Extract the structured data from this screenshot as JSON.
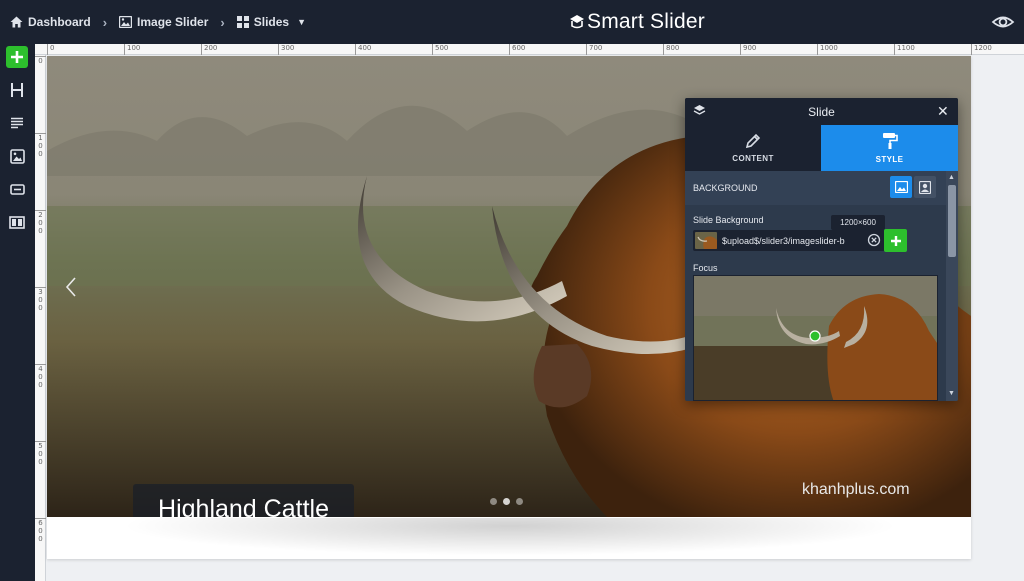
{
  "breadcrumb": {
    "items": [
      {
        "label": "Dashboard",
        "icon": "home-icon"
      },
      {
        "label": "Image Slider",
        "icon": "image-icon"
      },
      {
        "label": "Slides",
        "icon": "grid-icon"
      }
    ]
  },
  "logo": {
    "text": "Smart Slider"
  },
  "ruler": {
    "h_ticks": [
      "0",
      "100",
      "200",
      "300",
      "400",
      "500",
      "600",
      "700",
      "800",
      "900",
      "1000",
      "1100",
      "1200"
    ],
    "v_ticks": [
      "0",
      "1\n0\n0",
      "2\n0\n0",
      "3\n0\n0",
      "4\n0\n0",
      "5\n0\n0",
      "6\n0\n0"
    ]
  },
  "slide": {
    "caption": "Highland Cattle",
    "watermark": "khanhplus.com",
    "dots": 3
  },
  "panel": {
    "title": "Slide",
    "tabs": {
      "content": "CONTENT",
      "style": "STYLE"
    },
    "section_title": "BACKGROUND",
    "slide_background_label": "Slide Background",
    "size_badge": "1200×600",
    "file_value": "$upload$/slider3/imageslider-b",
    "focus_label": "Focus"
  },
  "colors": {
    "topbar": "#1b2230",
    "accent_blue": "#1c8ceb",
    "accent_green": "#2dbf2d",
    "panel_bg": "#2d3a4c"
  }
}
